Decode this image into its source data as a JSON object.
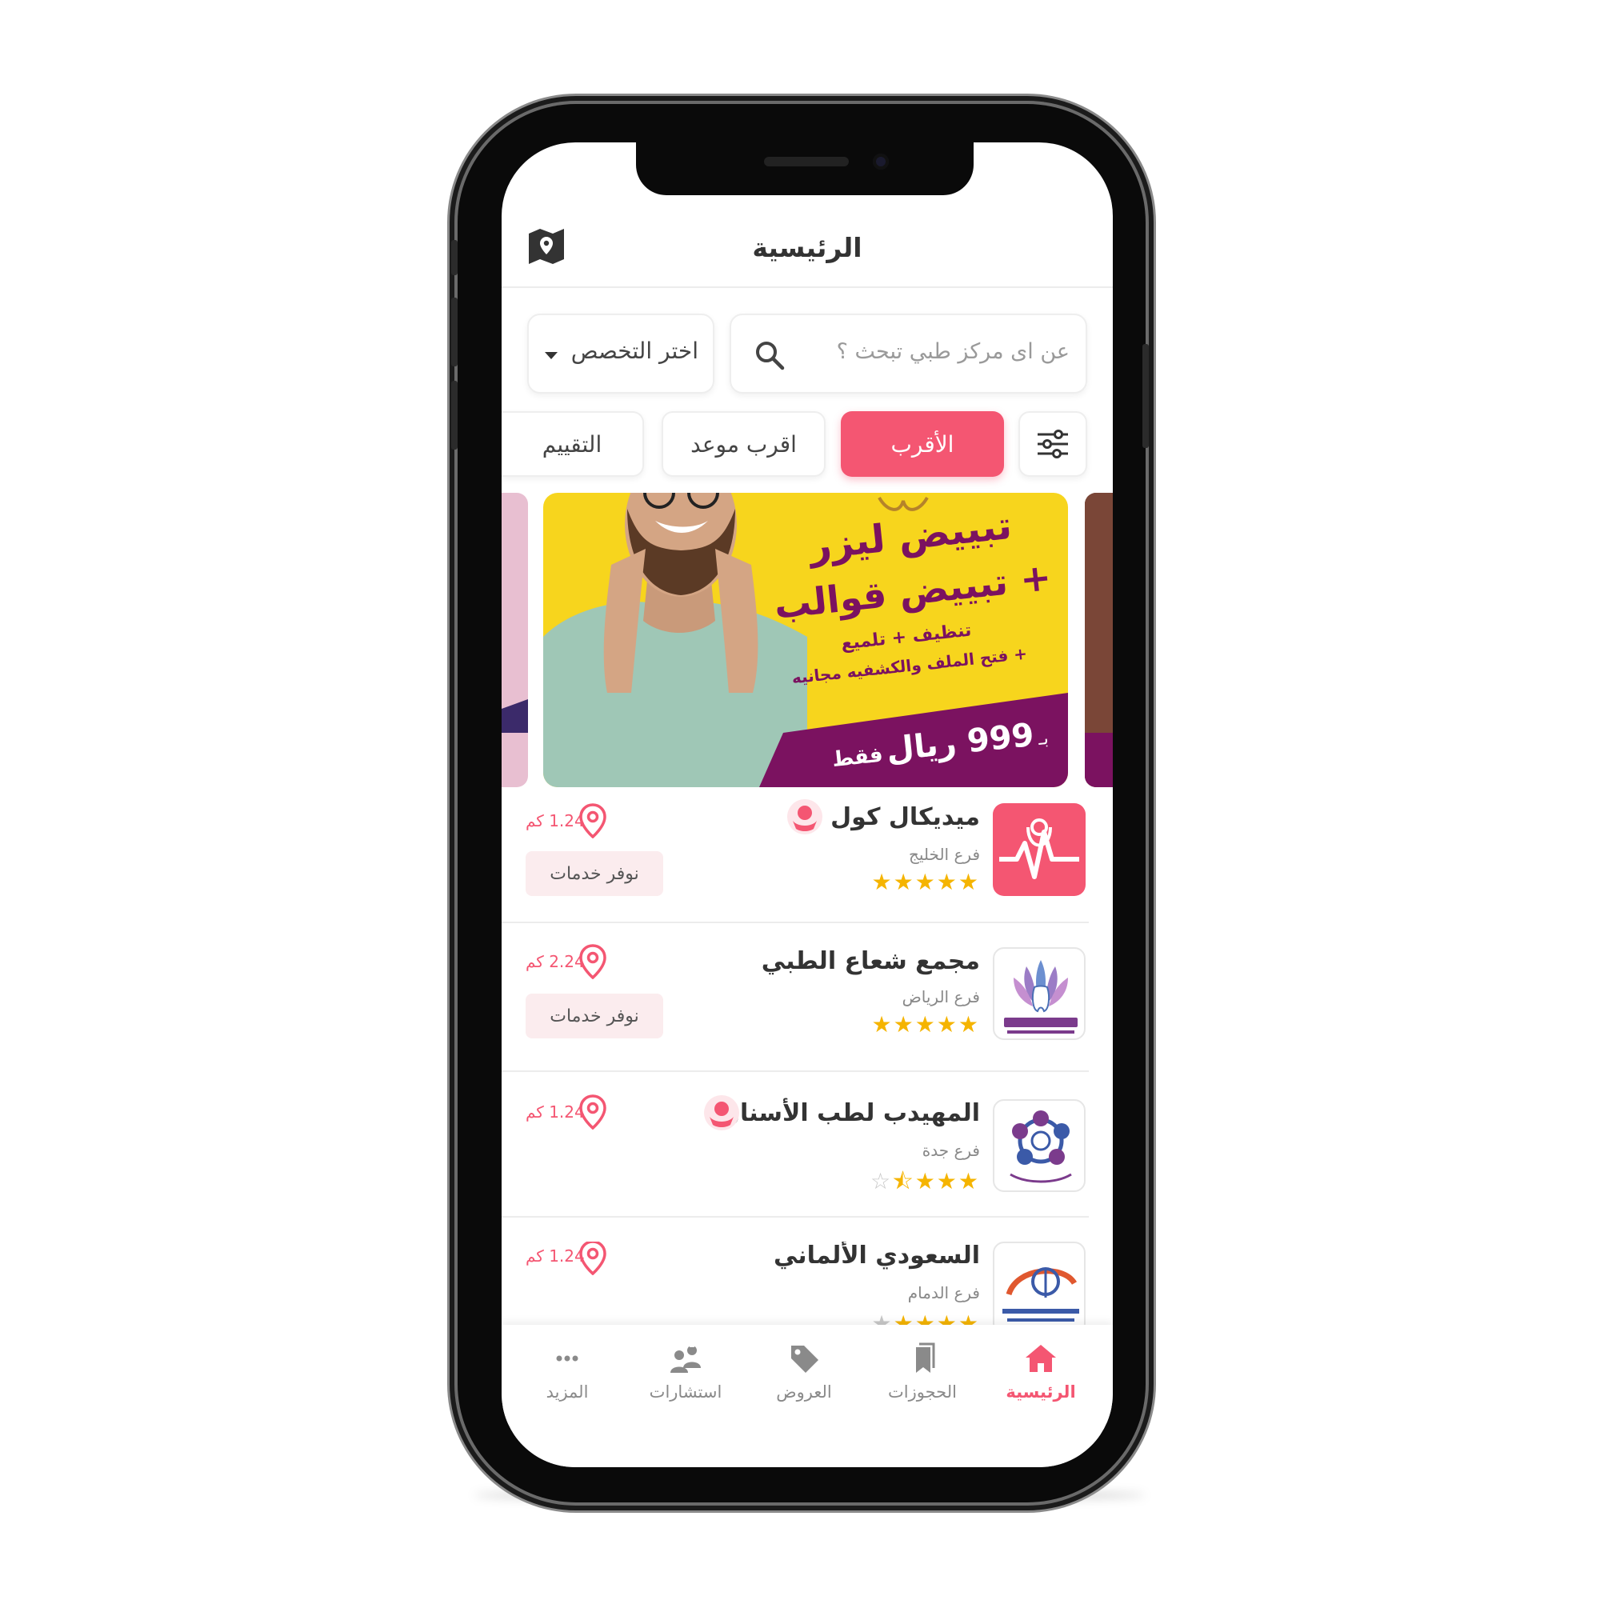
{
  "header": {
    "title": "الرئيسية",
    "map_icon": "map-icon"
  },
  "search": {
    "placeholder": "عن اى مركز طبي تبحث ؟",
    "icon": "search-icon"
  },
  "specialty": {
    "label": "اختر التخصص",
    "icon": "caret-down-icon"
  },
  "filters": {
    "settings_icon": "sliders-icon",
    "nearest": "الأقرب",
    "nearest_appt": "اقرب موعد",
    "rating": "التقييم"
  },
  "banner": {
    "line1": "تبييض ليزر",
    "line2": "+ تبييض قوالب",
    "line3": "تنظيف + تلميع",
    "line4": "+ فتح الملف والكشفيه مجانيه",
    "price_prefix": "بـ",
    "price": "999 ريال",
    "price_suffix": "فقط"
  },
  "centers": [
    {
      "name": "ميديكال كول",
      "branch": "فرع الخليج",
      "rating": 5,
      "distance": "1.24 كم",
      "services": "نوفر خدمات",
      "badge": true
    },
    {
      "name": "مجمع شعاع الطبي",
      "branch": "فرع الرياض",
      "rating": 5,
      "distance": "2.24 كم",
      "services": "نوفر خدمات",
      "badge": false
    },
    {
      "name": "المهيدب لطب الأسنان",
      "branch": "فرع جدة",
      "rating": 3.5,
      "distance": "1.24 كم",
      "badge": true
    },
    {
      "name": "السعودي الألماني",
      "branch": "فرع الدمام",
      "rating": 4,
      "distance": "1.24 كم",
      "badge": false
    }
  ],
  "tabs": [
    {
      "label": "الرئيسية",
      "icon": "home-icon",
      "active": true
    },
    {
      "label": "الحجوزات",
      "icon": "bookmarks-icon",
      "active": false
    },
    {
      "label": "العروض",
      "icon": "tag-icon",
      "active": false
    },
    {
      "label": "استشارات",
      "icon": "doctors-icon",
      "active": false
    },
    {
      "label": "المزيد",
      "icon": "more-icon",
      "active": false
    }
  ],
  "colors": {
    "accent": "#f45672",
    "star": "#f5b400",
    "banner_yellow": "#f7d51d",
    "banner_purple": "#7b1260"
  }
}
